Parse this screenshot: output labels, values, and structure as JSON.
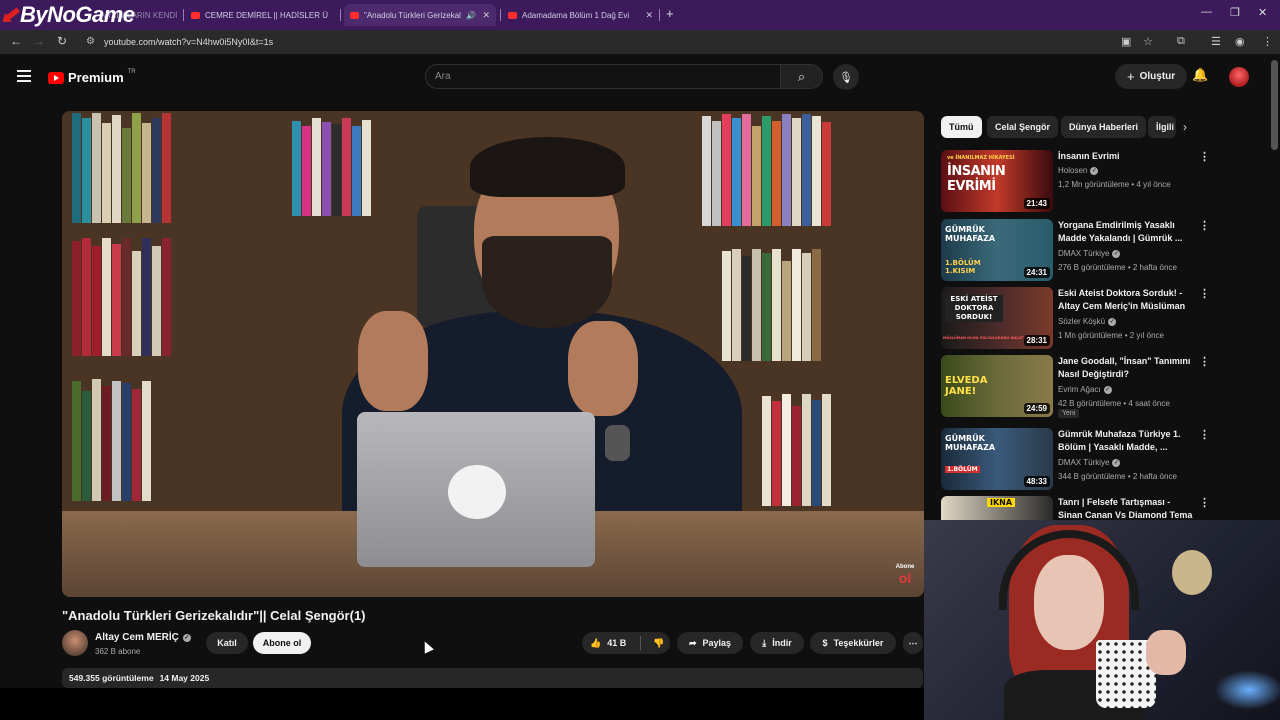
{
  "browser": {
    "overlay_logo": "ByNoGame",
    "tabs": [
      {
        "label": "ARABALARIN KENDİN..."
      },
      {
        "label": "CEMRE DEMİREL || HADİSLER Ü"
      },
      {
        "label": "\"Anadolu Türkleri Gerizekal"
      },
      {
        "label": "Adamadama Bölüm 1 Dağ Evi"
      }
    ],
    "url": "youtube.com/watch?v=N4hw0i5Ny0I&t=1s"
  },
  "header": {
    "logo_text": "Premium",
    "region": "TR",
    "search_placeholder": "Ara",
    "create_label": "Oluştur"
  },
  "video": {
    "title": "\"Anadolu Türkleri Gerizekalıdır\"|| Celal Şengör(1)",
    "overlay_abone_top": "Abone",
    "overlay_abone_bottom": "ol",
    "views": "549.355 görüntüleme",
    "date": "14 May 2025"
  },
  "channel": {
    "name": "Altay Cem MERİÇ",
    "subscribers": "362 B abone",
    "join_label": "Katıl",
    "subscribe_label": "Abone ol"
  },
  "actions": {
    "likes": "41 B",
    "share": "Paylaş",
    "download": "İndir",
    "thanks": "Teşekkürler"
  },
  "chips": [
    "Tümü",
    "Celal Şengör",
    "Dünya Haberleri",
    "İlgili"
  ],
  "recommendations": [
    {
      "title": "İnsanın Evrimi",
      "channel": "Holosen",
      "views": "1,2 Mn görüntüleme",
      "age": "4 yıl önce",
      "duration": "21:43",
      "thumb_text": "İNSANIN EVRİMİ",
      "thumb_sub": "ve İNANILMAZ HİKAYESİ",
      "new": ""
    },
    {
      "title": "Yorgana Emdirilmiş Yasaklı Madde Yakalandı | Gümrük ...",
      "channel": "DMAX Türkiye",
      "views": "276 B görüntüleme",
      "age": "2 hafta önce",
      "duration": "24:31",
      "thumb_text": "GÜMRÜK MUHAFAZA",
      "thumb_sub": "1.BÖLÜM 1.KISIM",
      "new": ""
    },
    {
      "title": "Eski Ateist Doktora Sorduk! - Altay Cem Meriç'in Müslüman ...",
      "channel": "Sözler Köşkü",
      "views": "1 Mn görüntüleme",
      "age": "2 yıl önce",
      "duration": "28:31",
      "thumb_text": "ESKİ ATEİST DOKTORA SORDUK!",
      "thumb_sub": "MÜSLÜMAN OLMA YOLCULUĞUNU ANLATTI",
      "new": ""
    },
    {
      "title": "Jane Goodall, \"İnsan\" Tanımını Nasıl Değiştirdi?",
      "channel": "Evrim Ağacı",
      "views": "42 B görüntüleme",
      "age": "4 saat önce",
      "duration": "24:59",
      "thumb_text": "ELVEDA JANE!",
      "thumb_sub": "",
      "new": "Yeni"
    },
    {
      "title": "Gümrük Muhafaza Türkiye 1. Bölüm | Yasaklı Madde, ...",
      "channel": "DMAX Türkiye",
      "views": "344 B görüntüleme",
      "age": "2 hafta önce",
      "duration": "48:33",
      "thumb_text": "GÜMRÜK MUHAFAZA",
      "thumb_sub": "1.BÖLÜM",
      "new": ""
    },
    {
      "title": "Tanrı | Felsefe Tartışması - Sinan Canan Vs Diamond Tema",
      "channel": "",
      "views": "",
      "age": "",
      "duration": "",
      "thumb_text": "IKNA",
      "thumb_sub": "",
      "new": ""
    }
  ],
  "colors": {
    "background": "#0f0f0f",
    "chrome_tabbar": "#3c1a5c",
    "yt_red": "#ff0000",
    "chip_bg": "#272727"
  }
}
